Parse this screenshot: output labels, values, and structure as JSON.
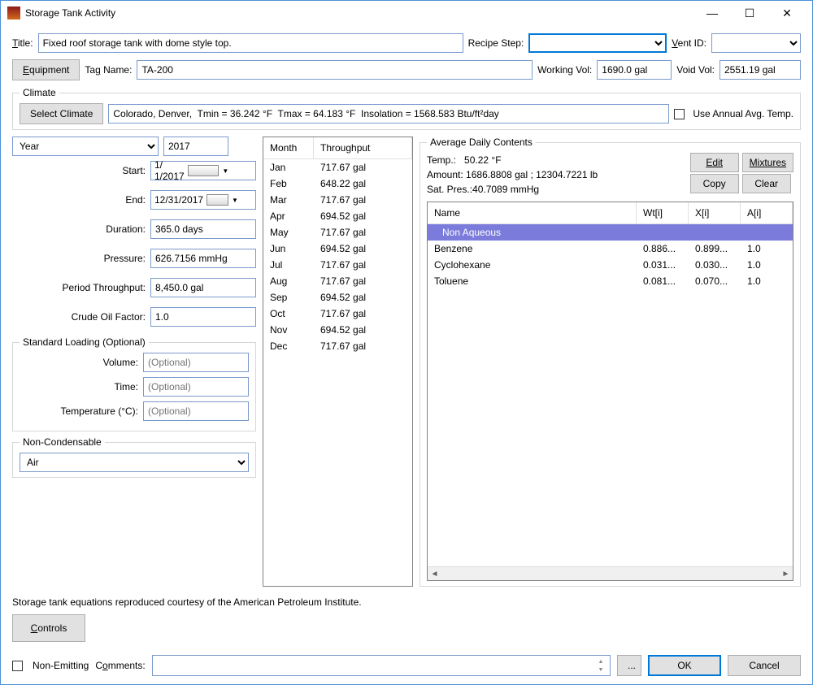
{
  "window": {
    "title": "Storage Tank Activity"
  },
  "header": {
    "title_label": "Title:",
    "title_value": "Fixed roof storage tank with dome style top.",
    "recipe_step_label": "Recipe Step:",
    "recipe_step_value": "",
    "vent_id_label": "Vent ID:",
    "vent_id_value": ""
  },
  "equip": {
    "equipment_btn": "Equipment",
    "tag_name_label": "Tag Name:",
    "tag_name_value": "TA-200",
    "working_vol_label": "Working Vol:",
    "working_vol_value": "1690.0 gal",
    "void_vol_label": "Void Vol:",
    "void_vol_value": "2551.19 gal"
  },
  "climate": {
    "legend": "Climate",
    "select_btn": "Select Climate",
    "summary": "Colorado, Denver,  Tmin = 36.242 °F  Tmax = 64.183 °F  Insolation = 1568.583 Btu/ft²day",
    "use_annual_label": "Use Annual Avg. Temp."
  },
  "period": {
    "year_label": "Year",
    "year_value": "2017",
    "start_label": "Start:",
    "start_value": "1/  1/2017",
    "end_label": "End:",
    "end_value": "12/31/2017",
    "duration_label": "Duration:",
    "duration_value": "365.0 days",
    "pressure_label": "Pressure:",
    "pressure_value": "626.7156 mmHg",
    "throughput_label": "Period Throughput:",
    "throughput_value": "8,450.0 gal",
    "crude_label": "Crude Oil Factor:",
    "crude_value": "1.0"
  },
  "std_loading": {
    "legend": "Standard Loading (Optional)",
    "volume_label": "Volume:",
    "volume_ph": "(Optional)",
    "time_label": "Time:",
    "time_ph": "(Optional)",
    "temp_label": "Temperature (°C):",
    "temp_ph": "(Optional)"
  },
  "noncond": {
    "legend": "Non-Condensable",
    "value": "Air"
  },
  "monthly": {
    "header_month": "Month",
    "header_tp": "Throughput",
    "rows": [
      {
        "month": "Jan",
        "tp": "717.67 gal"
      },
      {
        "month": "Feb",
        "tp": "648.22 gal"
      },
      {
        "month": "Mar",
        "tp": "717.67 gal"
      },
      {
        "month": "Apr",
        "tp": "694.52 gal"
      },
      {
        "month": "May",
        "tp": "717.67 gal"
      },
      {
        "month": "Jun",
        "tp": "694.52 gal"
      },
      {
        "month": "Jul",
        "tp": "717.67 gal"
      },
      {
        "month": "Aug",
        "tp": "717.67 gal"
      },
      {
        "month": "Sep",
        "tp": "694.52 gal"
      },
      {
        "month": "Oct",
        "tp": "717.67 gal"
      },
      {
        "month": "Nov",
        "tp": "694.52 gal"
      },
      {
        "month": "Dec",
        "tp": "717.67 gal"
      }
    ]
  },
  "contents": {
    "legend": "Average Daily Contents",
    "temp_label": "Temp.:",
    "temp_value": "50.22 °F",
    "amount_label": "Amount:",
    "amount_value": "1686.8808 gal ; 12304.7221 lb",
    "satpres_label": "Sat. Pres.:",
    "satpres_value": "40.7089 mmHg",
    "edit_btn": "Edit",
    "mixtures_btn": "Mixtures",
    "copy_btn": "Copy",
    "clear_btn": "Clear",
    "col_name": "Name",
    "col_wt": "Wt[i]",
    "col_x": "X[i]",
    "col_a": "A[i]",
    "rows": [
      {
        "name": "Non Aqueous",
        "wt": "",
        "x": "",
        "a": "",
        "selected": true,
        "indent": true
      },
      {
        "name": "Benzene",
        "wt": "0.886...",
        "x": "0.899...",
        "a": "1.0"
      },
      {
        "name": "Cyclohexane",
        "wt": "0.031...",
        "x": "0.030...",
        "a": "1.0"
      },
      {
        "name": "Toluene",
        "wt": "0.081...",
        "x": "0.070...",
        "a": "1.0"
      }
    ]
  },
  "footer_note": "Storage tank equations reproduced courtesy of the American Petroleum Institute.",
  "controls_btn": "Controls",
  "bottom": {
    "non_emitting_label": "Non-Emitting",
    "comments_label": "Comments:",
    "comments_value": "",
    "browse_btn": "...",
    "ok_btn": "OK",
    "cancel_btn": "Cancel"
  }
}
